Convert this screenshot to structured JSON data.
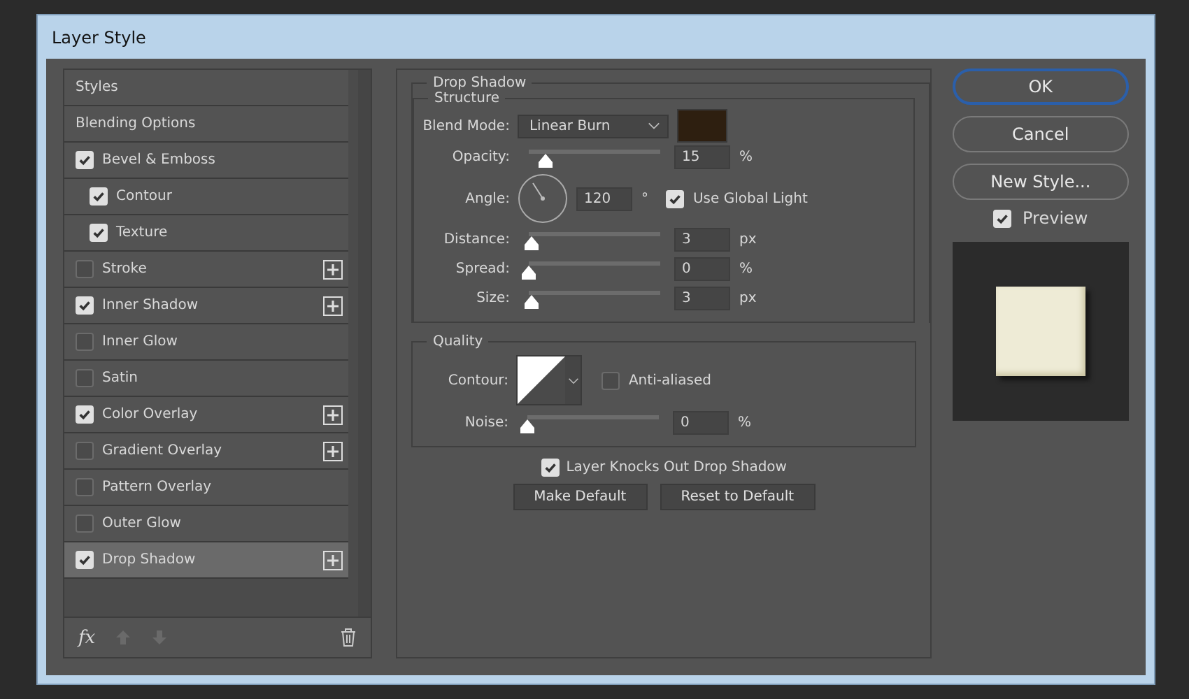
{
  "window": {
    "title": "Layer Style"
  },
  "styles_list": {
    "items": [
      {
        "label": "Styles",
        "kind": "header",
        "selected": false
      },
      {
        "label": "Blending Options",
        "kind": "header",
        "selected": false
      },
      {
        "label": "Bevel & Emboss",
        "kind": "effect",
        "checked": true,
        "selected": false,
        "addable": false,
        "children": [
          {
            "label": "Contour",
            "kind": "effect",
            "checked": true,
            "selected": false,
            "addable": false
          },
          {
            "label": "Texture",
            "kind": "effect",
            "checked": true,
            "selected": false,
            "addable": false
          }
        ]
      },
      {
        "label": "Stroke",
        "kind": "effect",
        "checked": false,
        "selected": false,
        "addable": true
      },
      {
        "label": "Inner Shadow",
        "kind": "effect",
        "checked": true,
        "selected": false,
        "addable": true
      },
      {
        "label": "Inner Glow",
        "kind": "effect",
        "checked": false,
        "selected": false,
        "addable": false
      },
      {
        "label": "Satin",
        "kind": "effect",
        "checked": false,
        "selected": false,
        "addable": false
      },
      {
        "label": "Color Overlay",
        "kind": "effect",
        "checked": true,
        "selected": false,
        "addable": true
      },
      {
        "label": "Gradient Overlay",
        "kind": "effect",
        "checked": false,
        "selected": false,
        "addable": true
      },
      {
        "label": "Pattern Overlay",
        "kind": "effect",
        "checked": false,
        "selected": false,
        "addable": false
      },
      {
        "label": "Outer Glow",
        "kind": "effect",
        "checked": false,
        "selected": false,
        "addable": false
      },
      {
        "label": "Drop Shadow",
        "kind": "effect",
        "checked": true,
        "selected": true,
        "addable": true
      }
    ],
    "fx_label": "fx"
  },
  "drop_shadow": {
    "title": "Drop Shadow",
    "structure": {
      "title": "Structure",
      "rows": [
        {
          "kind": "dropdown",
          "label": "Blend Mode:",
          "value": "Linear Burn",
          "color": "#2e1f10"
        },
        {
          "kind": "slider",
          "label": "Opacity:",
          "level": 0.12,
          "value": "15",
          "unit": "%"
        },
        {
          "kind": "angle",
          "label": "Angle:",
          "value": "120",
          "unit": "°",
          "checkbox": {
            "label": "Use Global Light",
            "checked": true
          }
        },
        {
          "kind": "slider",
          "label": "Distance:",
          "level": 0.02,
          "value": "3",
          "unit": "px"
        },
        {
          "kind": "slider",
          "label": "Spread:",
          "level": 0,
          "value": "0",
          "unit": "%"
        },
        {
          "kind": "slider",
          "label": "Size:",
          "level": 0.02,
          "value": "3",
          "unit": "px"
        }
      ]
    },
    "quality": {
      "title": "Quality",
      "rows": [
        {
          "kind": "contour",
          "label": "Contour:",
          "checkbox": {
            "label": "Anti-aliased",
            "checked": false
          }
        },
        {
          "kind": "slider",
          "label": "Noise:",
          "level": 0,
          "value": "0",
          "unit": "%"
        }
      ]
    },
    "knockout": {
      "label": "Layer Knocks Out Drop Shadow",
      "checked": true
    },
    "buttons": [
      "Make Default",
      "Reset to Default"
    ]
  },
  "actions": [
    {
      "label": "OK",
      "default": true
    },
    {
      "label": "Cancel",
      "default": false
    },
    {
      "label": "New Style...",
      "default": false
    }
  ],
  "preview": {
    "label": "Preview",
    "checked": true
  }
}
